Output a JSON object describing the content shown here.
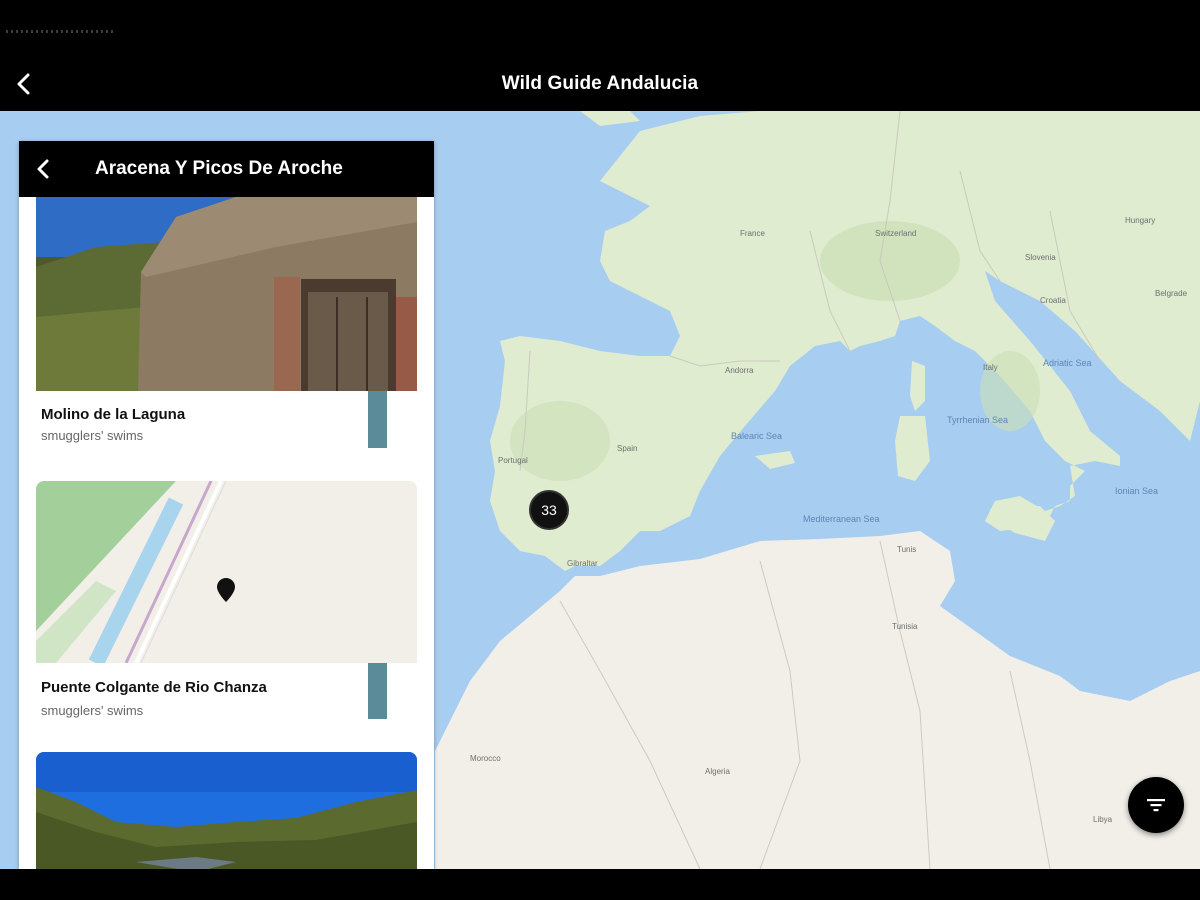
{
  "app": {
    "title": "Wild Guide Andalucia"
  },
  "panel": {
    "title": "Aracena Y Picos De Aroche",
    "cards": [
      {
        "name": "Molino de la Laguna",
        "category": "smugglers' swims"
      },
      {
        "name": "Puente Colgante de Rio Chanza",
        "category": "smugglers' swims"
      }
    ]
  },
  "map": {
    "cluster_count": "33",
    "labels": {
      "portugal": "Portugal",
      "spain": "Spain",
      "france": "France",
      "andorra": "Andorra",
      "italy": "Italy",
      "switzerland": "Switzerland",
      "slovenia": "Slovenia",
      "croatia": "Croatia",
      "hungary": "Hungary",
      "algeria": "Algeria",
      "tunisia": "Tunisia",
      "morocco": "Morocco",
      "libya": "Libya",
      "gibraltar": "Gibraltar",
      "balearic_sea": "Balearic Sea",
      "mediterranean_sea": "Mediterranean Sea",
      "tyrrhenian_sea": "Tyrrhenian Sea",
      "adriatic_sea": "Adriatic Sea",
      "ionian_sea": "Ionian Sea",
      "belgrade": "Belgrade",
      "tunis": "Tunis"
    }
  },
  "colors": {
    "appbar": "#000000",
    "water": "#a7cdf0",
    "land": "#f1efe8",
    "green_land": "#d8e8c6",
    "accent_strip": "#5b8a98"
  },
  "icons": {
    "back": "chevron-left-icon",
    "filter": "filter-icon",
    "pin": "map-pin-icon"
  }
}
